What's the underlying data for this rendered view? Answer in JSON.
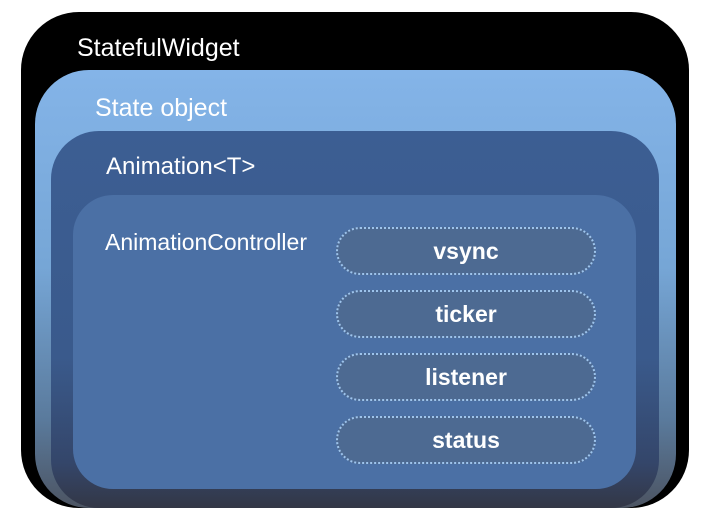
{
  "diagram": {
    "stateful_widget": {
      "label": "StatefulWidget"
    },
    "state_object": {
      "label": "State object"
    },
    "animation": {
      "label": "Animation<T>"
    },
    "animation_controller": {
      "label": "AnimationController",
      "properties": [
        "vsync",
        "ticker",
        "listener",
        "status"
      ]
    }
  },
  "colors": {
    "outer": "#000000",
    "state_object": "#7fb0e3",
    "animation": "#3c5e93",
    "animation_controller": "#4b70a5",
    "pill": "#4d6a92",
    "pill_border": "#9ec4ec",
    "text": "#ffffff"
  }
}
